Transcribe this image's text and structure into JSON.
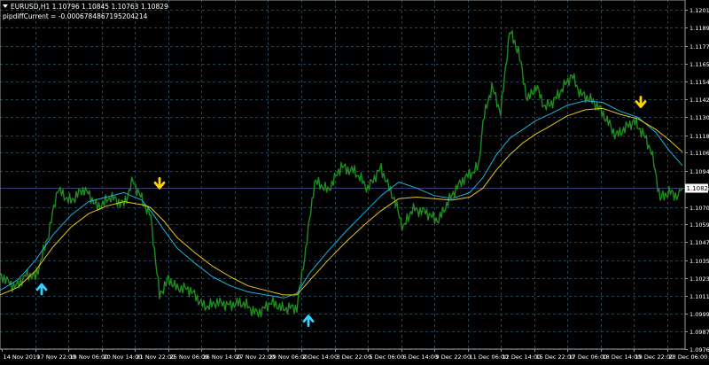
{
  "header": {
    "symbol_line": "EURUSD,H1  1.10796 1.10845 1.10763 1.10829",
    "indicator_line": "pipdiffCurrent = -0.0006784867195204214"
  },
  "colors": {
    "background": "#000000",
    "grid": "#2b3f4c",
    "price": "#1e8c1e",
    "ma_fast": "#19b4dc",
    "ma_slow": "#e6c819",
    "arrow_up": "#33d1ff",
    "arrow_down": "#ffd400",
    "current_line": "#3b3b7a",
    "price_box": "#ffffff",
    "price_box_text": "#000000",
    "axis_text": "#ffffff"
  },
  "chart_data": {
    "type": "line",
    "title": "EURUSD,H1",
    "ylim": [
      1.0976,
      1.1208
    ],
    "y_ticks": [
      "1.12015",
      "1.11895",
      "1.11775",
      "1.11655",
      "1.11540",
      "1.11420",
      "1.11300",
      "1.11180",
      "1.11065",
      "1.10945",
      "1.10830",
      "1.10705",
      "1.10590",
      "1.10470",
      "1.10350",
      "1.10230",
      "1.10115",
      "1.09995",
      "1.09875",
      "1.09760"
    ],
    "x_ticks": [
      "14 Nov 2019",
      "17 Nov 22:00",
      "19 Nov 06:00",
      "20 Nov 14:00",
      "21 Nov 22:00",
      "25 Nov 06:00",
      "26 Nov 14:00",
      "27 Nov 22:00",
      "29 Nov 06:00",
      "2 Dec 14:00",
      "3 Dec 22:00",
      "5 Dec 06:00",
      "6 Dec 14:00",
      "9 Dec 22:00",
      "11 Dec 06:00",
      "12 Dec 14:00",
      "15 Dec 22:00",
      "17 Dec 06:00",
      "18 Dec 14:00",
      "19 Dec 22:00",
      "23 Dec 06:00"
    ],
    "current_price": "1.10829",
    "series": [
      {
        "x": [
          0,
          20,
          40,
          55,
          65,
          80,
          95,
          110,
          125,
          140,
          150,
          160,
          170,
          180,
          190,
          200,
          215,
          230,
          245,
          260,
          275,
          290,
          305,
          320,
          335,
          345,
          355,
          370,
          385,
          400,
          415,
          430,
          445,
          455,
          465,
          480,
          495,
          510,
          525,
          540,
          545,
          555,
          565,
          575,
          585,
          595,
          605,
          615,
          625,
          635,
          645,
          655,
          665,
          675,
          685,
          695,
          705,
          715,
          725,
          735,
          745,
          755,
          765,
          770
        ],
        "values": [
          1.1022,
          1.102,
          1.1025,
          1.1055,
          1.1085,
          1.1075,
          1.108,
          1.107,
          1.108,
          1.1072,
          1.109,
          1.1078,
          1.1065,
          1.101,
          1.102,
          1.1015,
          1.1013,
          1.1006,
          1.1009,
          1.1003,
          1.1005,
          1.1002,
          1.1008,
          1.1,
          1.1003,
          1.104,
          1.1085,
          1.108,
          1.11,
          1.1095,
          1.108,
          1.1096,
          1.1078,
          1.1058,
          1.1068,
          1.107,
          1.1062,
          1.1076,
          1.109,
          1.11,
          1.1125,
          1.115,
          1.1135,
          1.119,
          1.1175,
          1.114,
          1.1148,
          1.1135,
          1.1142,
          1.1152,
          1.116,
          1.1145,
          1.114,
          1.1135,
          1.1128,
          1.112,
          1.1125,
          1.1128,
          1.1118,
          1.1105,
          1.1075,
          1.1082,
          1.108,
          1.1083
        ]
      },
      {
        "x": [
          0,
          20,
          40,
          60,
          80,
          100,
          120,
          140,
          160,
          170,
          185,
          200,
          220,
          240,
          260,
          280,
          300,
          320,
          335,
          350,
          370,
          390,
          410,
          430,
          450,
          470,
          490,
          510,
          530,
          545,
          560,
          575,
          590,
          605,
          620,
          640,
          660,
          680,
          700,
          720,
          740,
          755,
          770
        ],
        "values": [
          1.1015,
          1.1022,
          1.1035,
          1.1052,
          1.1065,
          1.1074,
          1.1077,
          1.108,
          1.1075,
          1.1068,
          1.1055,
          1.1043,
          1.1033,
          1.1024,
          1.1018,
          1.1014,
          1.1012,
          1.101,
          1.1013,
          1.1027,
          1.1041,
          1.1054,
          1.1066,
          1.1078,
          1.1087,
          1.1083,
          1.1078,
          1.1076,
          1.108,
          1.109,
          1.1105,
          1.1116,
          1.1122,
          1.1128,
          1.1132,
          1.1138,
          1.1141,
          1.114,
          1.1134,
          1.113,
          1.112,
          1.1108,
          1.1098
        ]
      },
      {
        "x": [
          0,
          20,
          40,
          60,
          80,
          100,
          120,
          140,
          160,
          170,
          185,
          200,
          220,
          240,
          260,
          280,
          300,
          320,
          335,
          350,
          370,
          390,
          410,
          430,
          450,
          470,
          490,
          510,
          530,
          545,
          560,
          575,
          590,
          605,
          620,
          640,
          660,
          680,
          700,
          720,
          740,
          755,
          770
        ],
        "values": [
          1.1012,
          1.1017,
          1.1028,
          1.1044,
          1.1057,
          1.1066,
          1.1071,
          1.1074,
          1.1072,
          1.107,
          1.1061,
          1.105,
          1.104,
          1.1031,
          1.1024,
          1.1018,
          1.1015,
          1.1012,
          1.1012,
          1.1022,
          1.1035,
          1.1047,
          1.1058,
          1.1068,
          1.1076,
          1.1077,
          1.1076,
          1.1075,
          1.1077,
          1.1083,
          1.1095,
          1.1105,
          1.1113,
          1.1119,
          1.1124,
          1.1131,
          1.1135,
          1.1136,
          1.1132,
          1.1129,
          1.1122,
          1.1115,
          1.1107
        ]
      }
    ],
    "arrows": [
      {
        "dir": "up",
        "x": 47,
        "value": 1.1019
      },
      {
        "dir": "down",
        "x": 180,
        "value": 1.1083
      },
      {
        "dir": "up",
        "x": 348,
        "value": 1.0998
      },
      {
        "dir": "down",
        "x": 723,
        "value": 1.1137
      }
    ]
  }
}
